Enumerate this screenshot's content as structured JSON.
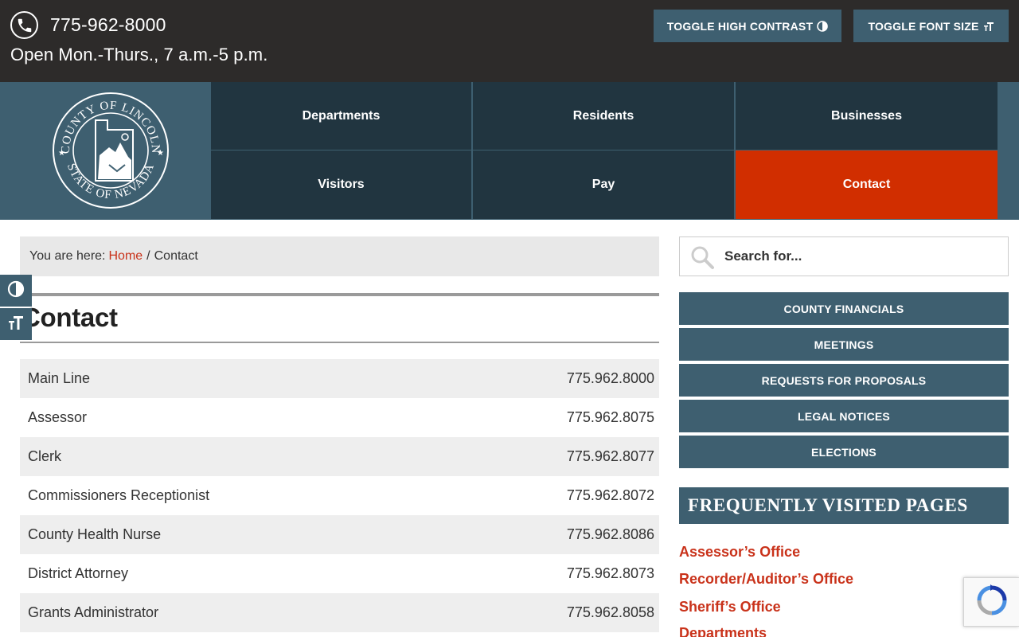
{
  "topbar": {
    "phone": "775-962-8000",
    "hours": "Open Mon.-Thurs., 7 a.m.-5 p.m.",
    "toggle_contrast_label": "TOGGLE HIGH CONTRAST",
    "toggle_font_label": "TOGGLE FONT SIZE"
  },
  "logo": {
    "top_text": "COUNTY OF LINCOLN",
    "bottom_text": "STATE OF NEVADA"
  },
  "nav": {
    "items": [
      {
        "label": "Departments"
      },
      {
        "label": "Residents"
      },
      {
        "label": "Businesses"
      },
      {
        "label": "Visitors"
      },
      {
        "label": "Pay"
      },
      {
        "label": "Contact"
      }
    ]
  },
  "breadcrumb": {
    "prefix": "You are here:",
    "home": "Home",
    "separator": "/",
    "current": "Contact"
  },
  "page": {
    "title": "Contact"
  },
  "contacts": [
    {
      "name": "Main Line",
      "phone": "775.962.8000"
    },
    {
      "name": "Assessor",
      "phone": "775.962.8075"
    },
    {
      "name": "Clerk",
      "phone": "775.962.8077"
    },
    {
      "name": "Commissioners Receptionist",
      "phone": "775.962.8072"
    },
    {
      "name": "County Health Nurse",
      "phone": "775.962.8086"
    },
    {
      "name": "District Attorney",
      "phone": "775.962.8073"
    },
    {
      "name": "Grants Administrator",
      "phone": "775.962.8058"
    }
  ],
  "sidebar": {
    "search_placeholder": "Search for...",
    "buttons": [
      {
        "label": "COUNTY FINANCIALS"
      },
      {
        "label": "MEETINGS"
      },
      {
        "label": "REQUESTS FOR PROPOSALS"
      },
      {
        "label": "LEGAL NOTICES"
      },
      {
        "label": "ELECTIONS"
      }
    ],
    "fvp_title": "FREQUENTLY VISITED PAGES",
    "fvp_links": [
      {
        "label": "Assessor’s Office"
      },
      {
        "label": "Recorder/Auditor’s Office"
      },
      {
        "label": "Sheriff’s Office"
      },
      {
        "label": "Departments"
      }
    ]
  },
  "colors": {
    "topbar_bg": "#2d2b2a",
    "brand_blue": "#3e5f70",
    "nav_dark": "#213540",
    "accent_red": "#d12e00",
    "link_red": "#c9321a"
  }
}
